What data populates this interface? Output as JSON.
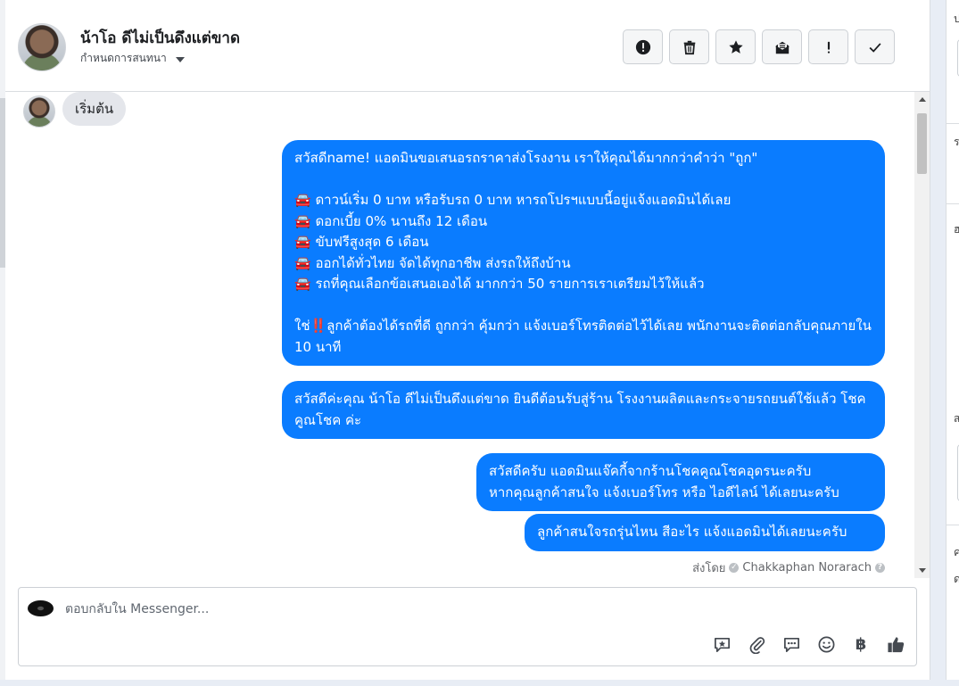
{
  "conversation": {
    "contact_name": "น้าโอ ดีไม่เป็นดึงแต่ขาด",
    "assign_label": "กำหนดการสนทนา",
    "actions": [
      {
        "icon": "alert-circle-icon"
      },
      {
        "icon": "trash-icon"
      },
      {
        "icon": "star-icon"
      },
      {
        "icon": "mark-unread-icon"
      },
      {
        "icon": "exclamation-icon"
      },
      {
        "icon": "check-icon"
      }
    ]
  },
  "messages": {
    "incoming": [
      {
        "text": "เริ่มต้น"
      }
    ],
    "outgoing": [
      {
        "text": "สวัสดีname! แอดมินขอเสนอรถราคาส่งโรงงาน เราให้คุณได้มากกว่าคำว่า \"ถูก\"\n\n🚘 ดาวน์เริ่ม 0 บาท หรือรับรถ 0 บาท หารถโปรฯแบบนี้อยู่แจ้งแอดมินได้เลย\n🚘 ดอกเบี้ย 0% นานถึง 12 เดือน\n🚘 ขับฟรีสูงสุด 6 เดือน\n🚘 ออกได้ทั่วไทย จัดได้ทุกอาชีพ ส่งรถให้ถึงบ้าน\n🚘 รถที่คุณเลือกข้อเสนอเองได้ มากกว่า 50 รายการเราเตรียมไว้ให้แล้ว\n\nใช่‼️ลูกค้าต้องได้รถที่ดี ถูกกว่า คุ้มกว่า แจ้งเบอร์โทรติดต่อไว้ได้เลย พนักงานจะติดต่อกลับคุณภายใน 10 นาที"
      },
      {
        "text": "สวัสดีค่ะคุณ น้าโอ ดีไม่เป็นดึงแต่ขาด ยินดีต้อนรับสู่ร้าน โรงงานผลิตและกระจายรถยนต์ใช้แล้ว โชคคูณโชค ค่ะ"
      },
      {
        "text": "สวัสดีครับ แอดมินแจ๊คกี้จากร้านโชคคูณโชคอุดรนะครับ\nหากคุณลูกค้าสนใจ แจ้งเบอร์โทร หรือ ไอดีไลน์ ได้เลยนะครับ"
      },
      {
        "text": "ลูกค้าสนใจรถรุ่นไหน สีอะไร แจ้งแอดมินได้เลยนะครับ"
      }
    ],
    "sent_by_prefix": "ส่งโดย",
    "sent_by_name": "Chakkaphan Norarach"
  },
  "composer": {
    "placeholder": "ตอบกลับใน Messenger...",
    "value": "",
    "tools": [
      "sticker-icon",
      "attachment-icon",
      "saved-replies-icon",
      "emoji-icon",
      "baht-payment-icon",
      "like-icon"
    ],
    "baht_symbol": "฿"
  },
  "right_panel": {
    "marks": [
      "ป",
      "ร",
      "ฮ",
      "ส",
      "ค",
      "ด"
    ]
  },
  "colors": {
    "outgoing_bubble": "#0a7cff",
    "incoming_bubble": "#e4e6eb",
    "like_icon": "#444950"
  }
}
